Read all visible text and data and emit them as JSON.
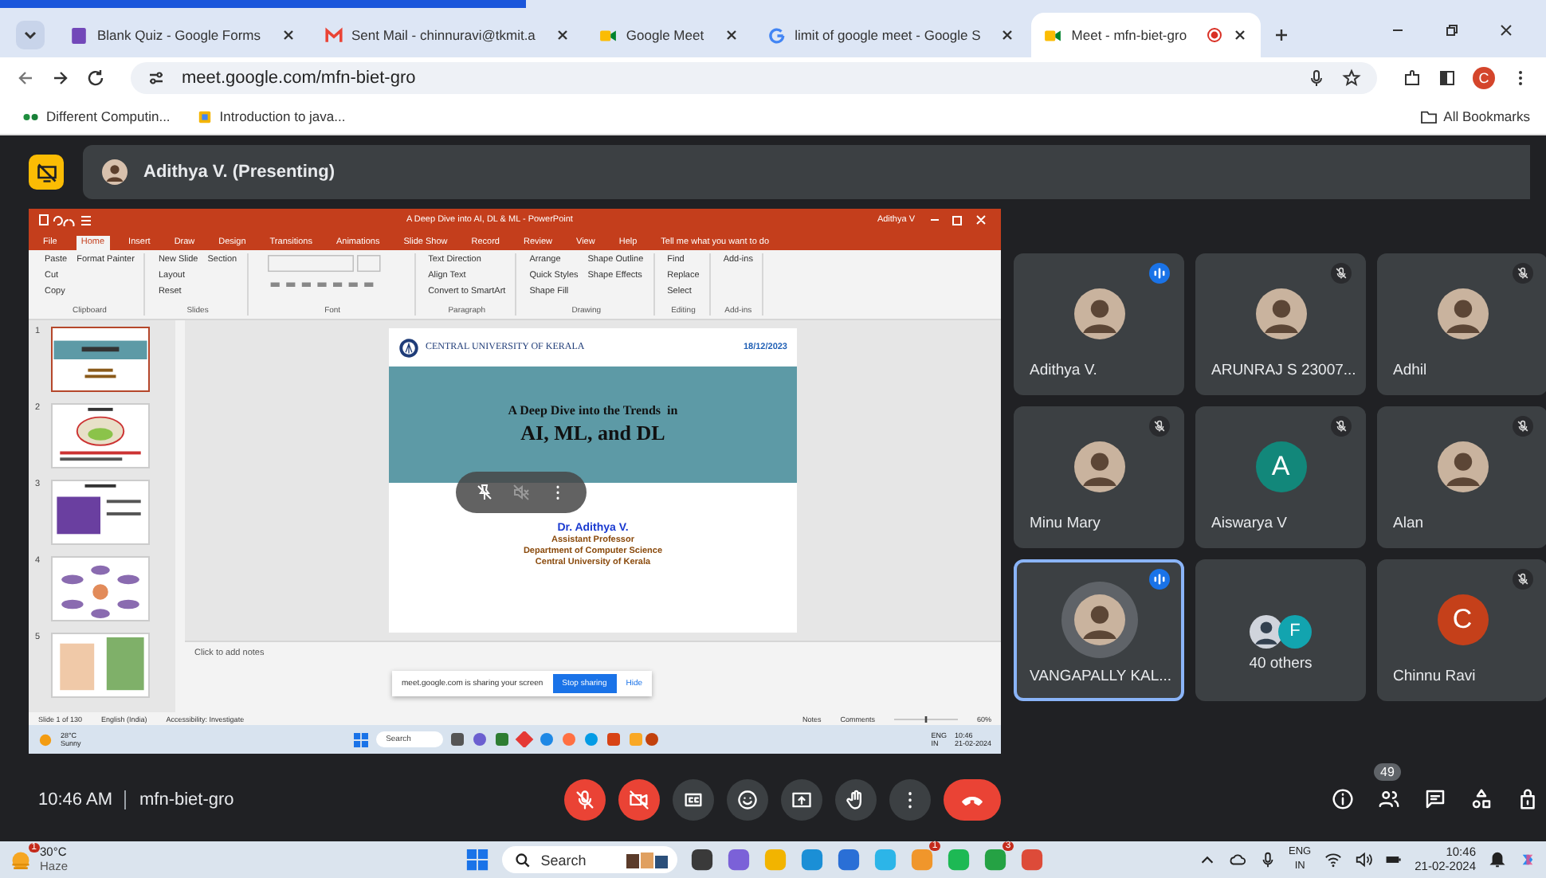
{
  "browser": {
    "tabs": [
      {
        "title": "Blank Quiz - Google Forms",
        "kind": "forms",
        "selected": false,
        "recording": false
      },
      {
        "title": "Sent Mail - chinnuravi@tkmit.a",
        "kind": "mail",
        "selected": false,
        "recording": false
      },
      {
        "title": "Google Meet",
        "kind": "meet",
        "selected": false,
        "recording": false
      },
      {
        "title": "limit of google meet - Google S",
        "kind": "google",
        "selected": false,
        "recording": false
      },
      {
        "title": "Meet - mfn-biet-gro",
        "kind": "meet",
        "selected": true,
        "recording": true
      }
    ],
    "url": "meet.google.com/mfn-biet-gro",
    "profile_initial": "C",
    "bookmarks": [
      {
        "label": "Different Computin...",
        "kind": "dots"
      },
      {
        "label": "Introduction to java...",
        "kind": "page"
      }
    ],
    "all_bookmarks": "All Bookmarks"
  },
  "meet": {
    "presenter": "Adithya V. (Presenting)",
    "powerpoint": {
      "title": "A Deep Dive into AI, DL & ML  -  PowerPoint",
      "user": "Adithya V",
      "menu": [
        {
          "label": "File",
          "selected": false
        },
        {
          "label": "Home",
          "selected": true
        },
        {
          "label": "Insert",
          "selected": false
        },
        {
          "label": "Draw",
          "selected": false
        },
        {
          "label": "Design",
          "selected": false
        },
        {
          "label": "Transitions",
          "selected": false
        },
        {
          "label": "Animations",
          "selected": false
        },
        {
          "label": "Slide Show",
          "selected": false
        },
        {
          "label": "Record",
          "selected": false
        },
        {
          "label": "Review",
          "selected": false
        },
        {
          "label": "View",
          "selected": false
        },
        {
          "label": "Help",
          "selected": false
        }
      ],
      "tell_me": "Tell me what you want to do",
      "ribbon": [
        {
          "label": "Clipboard",
          "items": [
            "Paste",
            "Cut",
            "Copy",
            "Format Painter"
          ]
        },
        {
          "label": "Slides",
          "items": [
            "New Slide",
            "Layout",
            "Reset",
            "Section"
          ]
        },
        {
          "label": "Font"
        },
        {
          "label": "Paragraph",
          "items": [
            "Text Direction",
            "Align Text",
            "Convert to SmartArt"
          ]
        },
        {
          "label": "Drawing",
          "items": [
            "Arrange",
            "Quick Styles",
            "Shape Fill",
            "Shape Outline",
            "Shape Effects"
          ]
        },
        {
          "label": "Editing",
          "items": [
            "Find",
            "Replace",
            "Select"
          ]
        },
        {
          "label": "Add-ins",
          "items": [
            "Add-ins"
          ]
        }
      ],
      "thumbnails": [
        {
          "number": "1",
          "selected": true,
          "kind": "title"
        },
        {
          "number": "2",
          "selected": false,
          "kind": "diagram"
        },
        {
          "number": "3",
          "selected": false,
          "kind": "image"
        },
        {
          "number": "4",
          "selected": false,
          "kind": "mindmap"
        },
        {
          "number": "5",
          "selected": false,
          "kind": "photos"
        }
      ],
      "slide": {
        "university": "CENTRAL UNIVERSITY OF KERALA",
        "date": "18/12/2023",
        "subtitle": "A Deep Dive into the Trends  in",
        "title": "AI, ML, and DL",
        "author": "Dr. Adithya V.",
        "role": "Assistant Professor",
        "department": "Department of Computer Science",
        "institution": "Central University of Kerala"
      },
      "notes_placeholder": "Click to add notes",
      "share_notice": {
        "text": "meet.google.com is sharing your screen",
        "stop": "Stop sharing",
        "hide": "Hide"
      },
      "status": {
        "slide": "Slide 1 of 130",
        "language": "English (India)",
        "accessibility": "Accessibility: Investigate",
        "notes": "Notes",
        "comments": "Comments",
        "zoom_slider": {
          "level": 0.5
        },
        "zoom": "60%"
      },
      "presenter_taskbar": {
        "temperature": "28°C",
        "weather": "Sunny",
        "search": "Search",
        "language": [
          "ENG",
          "IN"
        ],
        "time": "10:46",
        "date": "21-02-2024"
      }
    },
    "participants": [
      {
        "name": "Adithya V.",
        "kind": "photo",
        "muted": false,
        "selected": false
      },
      {
        "name": "ARUNRAJ S 23007...",
        "kind": "photo",
        "muted": true,
        "selected": false
      },
      {
        "name": "Adhil",
        "kind": "photo",
        "muted": true,
        "selected": false
      },
      {
        "name": "Minu Mary",
        "kind": "photo",
        "muted": true,
        "selected": false
      },
      {
        "name": "Aiswarya V",
        "kind": "letter",
        "letter": "A",
        "color": "#12877a",
        "muted": true,
        "selected": false
      },
      {
        "name": "Alan",
        "kind": "photo",
        "muted": true,
        "selected": false
      },
      {
        "name": "VANGAPALLY KAL...",
        "kind": "photo",
        "muted": false,
        "selected": true
      },
      {
        "name": "40 others",
        "kind": "others",
        "letter": "F",
        "color": "#12a4af",
        "selected": false
      },
      {
        "name": "Chinnu Ravi",
        "kind": "letter",
        "letter": "C",
        "color": "#c5401a",
        "muted": true,
        "selected": false
      }
    ],
    "time": "10:46 AM",
    "meeting_code": "mfn-biet-gro",
    "controls": [
      {
        "kind": "mic",
        "off": true
      },
      {
        "kind": "camera",
        "off": true
      },
      {
        "kind": "captions",
        "off": false
      },
      {
        "kind": "emoji",
        "off": false
      },
      {
        "kind": "present",
        "off": false
      },
      {
        "kind": "hand",
        "off": false
      },
      {
        "kind": "more",
        "off": false
      },
      {
        "kind": "end"
      }
    ],
    "side_controls": [
      {
        "kind": "info"
      },
      {
        "kind": "people",
        "badge": "49"
      },
      {
        "kind": "chat"
      },
      {
        "kind": "activities"
      },
      {
        "kind": "host"
      }
    ]
  },
  "taskbar": {
    "weather_badge": "1",
    "temperature": "30°C",
    "weather": "Haze",
    "search": "Search",
    "apps": [
      {
        "color": "#3a3a3a"
      },
      {
        "color": "#7b61d8"
      },
      {
        "color": "#f2b400"
      },
      {
        "color": "#1b8fd6"
      },
      {
        "color": "#2a6fd6"
      },
      {
        "color": "#2cb5e8"
      },
      {
        "color": "#f0962b",
        "badge": "1"
      },
      {
        "color": "#1db954"
      },
      {
        "color": "#25a244",
        "badge": "3"
      },
      {
        "color": "#dd4b39"
      }
    ],
    "language": [
      "ENG",
      "IN"
    ],
    "time": "10:46",
    "date": "21-02-2024"
  }
}
